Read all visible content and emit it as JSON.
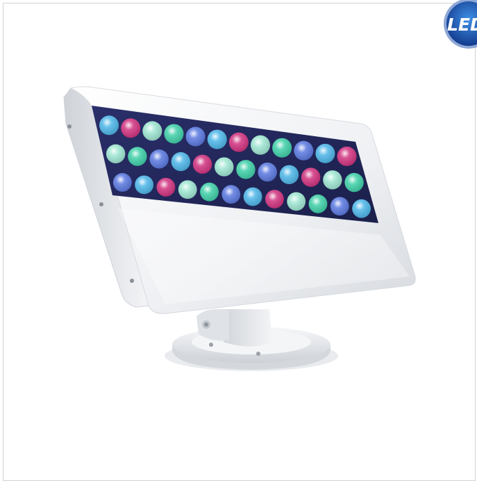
{
  "badge": {
    "text": "LED",
    "outer_color": "#1d4ba8",
    "inner_color": "#2f7ad9",
    "text_color": "#ffffff"
  },
  "product": {
    "body_color": "#f2f3f5",
    "shadow_color": "#d9dbdf",
    "led_colors": [
      "#4db6e8",
      "#3fd0a8",
      "#d1327f",
      "#5a78e0",
      "#9fe6d2"
    ]
  }
}
